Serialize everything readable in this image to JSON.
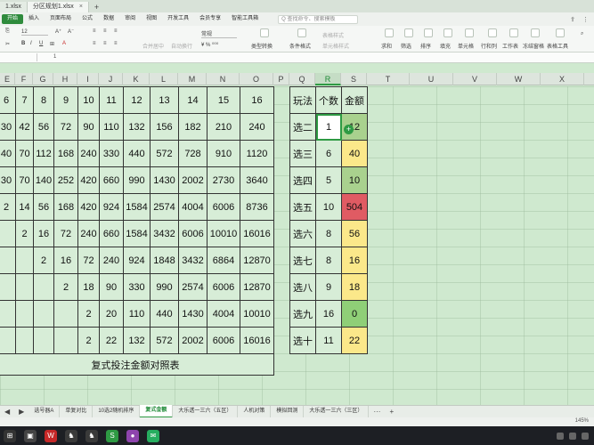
{
  "title_bar": {
    "tabs": [
      {
        "label": "1.xlsx",
        "active": false
      },
      {
        "label": "分区规划1.xlsx",
        "active": true
      }
    ],
    "new_tab_icon": "plus-icon"
  },
  "menu": {
    "items": [
      "开始",
      "插入",
      "页面布局",
      "公式",
      "数据",
      "审阅",
      "视图",
      "开发工具",
      "会员专享",
      "智能工具箱"
    ],
    "active_index": 0,
    "search_placeholder": "Q 查找命令、搜索模板"
  },
  "ribbon": {
    "font_size": "12",
    "number_format": "常规",
    "labels": {
      "merge": "合并居中",
      "wrap": "自动换行",
      "type_convert": "类型转换",
      "cond_format": "条件格式",
      "table_style": "表格样式",
      "cell_style": "单元格样式",
      "sum": "求和",
      "filter": "筛选",
      "sort": "排序",
      "fill": "填充",
      "cell": "单元格",
      "row_col": "行和列",
      "worksheet": "工作表",
      "freeze": "冻结窗格",
      "table_tools": "表格工具"
    }
  },
  "formula_bar": {
    "value": "1"
  },
  "columns": [
    "E",
    "F",
    "G",
    "H",
    "I",
    "J",
    "K",
    "L",
    "M",
    "N",
    "O",
    "P",
    "Q",
    "R",
    "S",
    "T",
    "U",
    "V",
    "W",
    "X"
  ],
  "selected_column": "R",
  "main_table": {
    "header": [
      "6",
      "7",
      "8",
      "9",
      "10",
      "11",
      "12",
      "13",
      "14",
      "15",
      "16"
    ],
    "rows": [
      [
        "30",
        "42",
        "56",
        "72",
        "90",
        "110",
        "132",
        "156",
        "182",
        "210",
        "240"
      ],
      [
        "40",
        "70",
        "112",
        "168",
        "240",
        "330",
        "440",
        "572",
        "728",
        "910",
        "1120"
      ],
      [
        "30",
        "70",
        "140",
        "252",
        "420",
        "660",
        "990",
        "1430",
        "2002",
        "2730",
        "3640"
      ],
      [
        "2",
        "14",
        "56",
        "168",
        "420",
        "924",
        "1584",
        "2574",
        "4004",
        "6006",
        "8736"
      ],
      [
        "",
        "2",
        "16",
        "72",
        "240",
        "660",
        "1584",
        "3432",
        "6006",
        "10010",
        "16016"
      ],
      [
        "",
        "",
        "2",
        "16",
        "72",
        "240",
        "924",
        "1848",
        "3432",
        "6864",
        "12870"
      ],
      [
        "",
        "",
        "",
        "2",
        "18",
        "90",
        "330",
        "990",
        "2574",
        "6006",
        "12870"
      ],
      [
        "",
        "",
        "",
        "",
        "2",
        "20",
        "110",
        "440",
        "1430",
        "4004",
        "10010"
      ],
      [
        "",
        "",
        "",
        "",
        "",
        "2",
        "22",
        "132",
        "572",
        "2002",
        "6006",
        "16016"
      ]
    ],
    "caption": "复式投注金额对照表"
  },
  "side_table": {
    "headers": [
      "玩法",
      "个数",
      "金额"
    ],
    "rows": [
      {
        "play": "选二",
        "count": "1",
        "amount": "12",
        "color": "#a9d18e"
      },
      {
        "play": "选三",
        "count": "6",
        "amount": "40",
        "color": "#fbe88a"
      },
      {
        "play": "选四",
        "count": "5",
        "amount": "10",
        "color": "#a9d18e"
      },
      {
        "play": "选五",
        "count": "10",
        "amount": "504",
        "color": "#e05b63"
      },
      {
        "play": "选六",
        "count": "8",
        "amount": "56",
        "color": "#fbe88a"
      },
      {
        "play": "选七",
        "count": "8",
        "amount": "16",
        "color": "#fbe88a"
      },
      {
        "play": "选八",
        "count": "9",
        "amount": "18",
        "color": "#fbe88a"
      },
      {
        "play": "选九",
        "count": "16",
        "amount": "0",
        "color": "#8fcf77"
      },
      {
        "play": "选十",
        "count": "11",
        "amount": "22",
        "color": "#fbe88a"
      }
    ]
  },
  "sheet_tabs": {
    "items": [
      "选号器A",
      "单复对比",
      "10选2随机排序",
      "复式金额",
      "大乐透一三六（五区）",
      "人机对策",
      "模拟回测",
      "大乐透一三六（三区）"
    ],
    "active_index": 3
  },
  "status": {
    "zoom": "145%"
  }
}
